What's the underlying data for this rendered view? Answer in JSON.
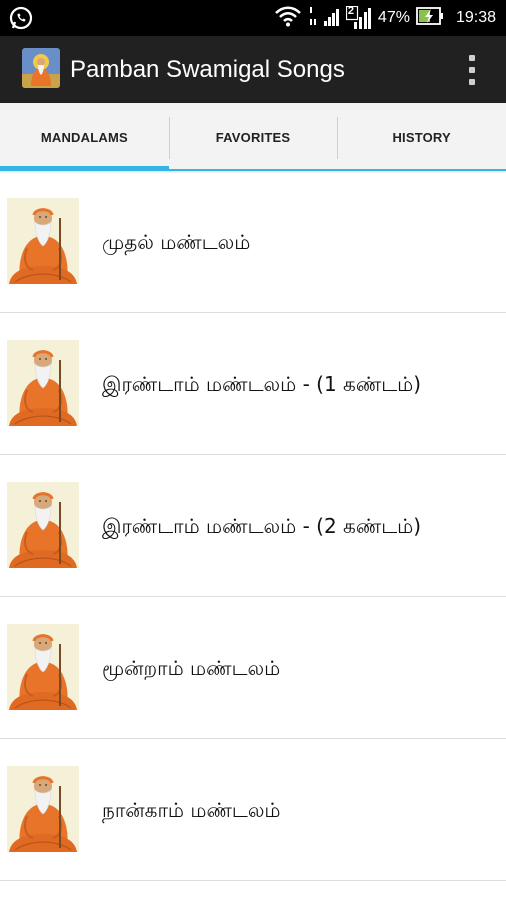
{
  "status_bar": {
    "left_icon": "whatsapp-icon",
    "sim_label": "2",
    "battery_percent": "47%",
    "time": "19:38"
  },
  "action_bar": {
    "title": "Pamban Swamigal Songs",
    "app_icon": "swami-app-icon",
    "overflow_icon": "overflow-menu-icon"
  },
  "tabs": [
    {
      "label": "MANDALAMS",
      "selected": true
    },
    {
      "label": "FAVORITES",
      "selected": false
    },
    {
      "label": "HISTORY",
      "selected": false
    }
  ],
  "list": {
    "items": [
      {
        "label": "முதல் மண்டலம்",
        "thumb": "swami-thumbnail"
      },
      {
        "label": "இரண்டாம் மண்டலம் - (1 கண்டம்)",
        "thumb": "swami-thumbnail"
      },
      {
        "label": "இரண்டாம் மண்டலம் - (2 கண்டம்)",
        "thumb": "swami-thumbnail"
      },
      {
        "label": "மூன்றாம் மண்டலம்",
        "thumb": "swami-thumbnail"
      },
      {
        "label": "நான்காம் மண்டலம்",
        "thumb": "swami-thumbnail"
      }
    ]
  },
  "colors": {
    "tab_indicator": "#33b5e5",
    "action_bar": "#212121",
    "status_bar": "#000000",
    "robe": "#e8742a"
  }
}
